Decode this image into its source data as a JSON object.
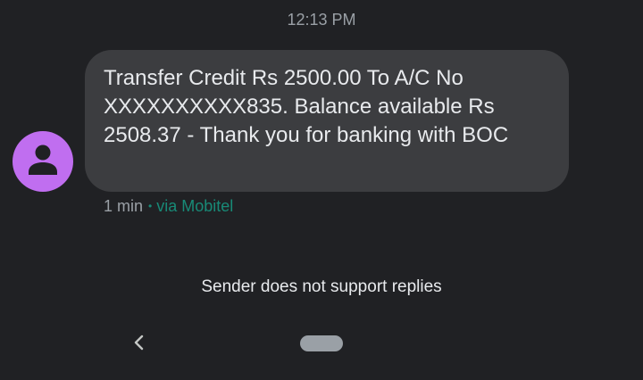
{
  "conversation": {
    "timestamp": "12:13 PM"
  },
  "message": {
    "text": "Transfer Credit Rs 2500.00 To A/C No XXXXXXXXXX835. Balance available Rs 2508.37 - Thank you for banking with BOC",
    "age": "1 min",
    "separator": "•",
    "carrier": "via Mobitel",
    "bubble_color": "#3c3d40",
    "avatar_color": "#c06ef0",
    "avatar_icon": "person-icon"
  },
  "footer": {
    "notice": "Sender does not support replies"
  },
  "navigation": {
    "back_icon": "chevron-left-icon",
    "home_icon": "home-pill-icon"
  },
  "colors": {
    "background": "#202124",
    "carrier_accent": "#188a77"
  }
}
